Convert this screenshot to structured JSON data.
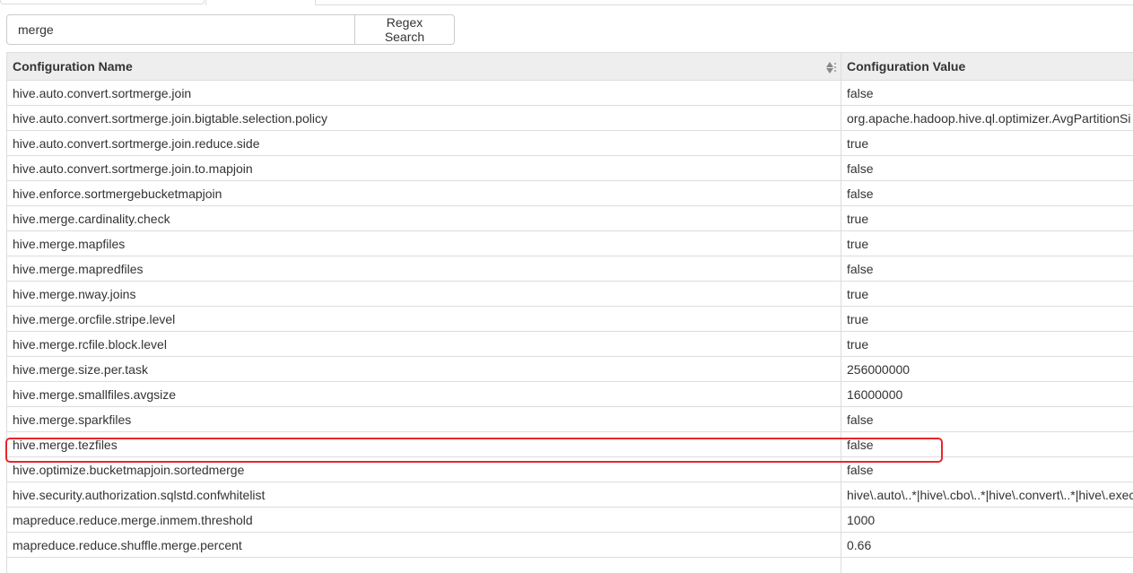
{
  "search": {
    "value": "merge",
    "button_label": "Regex Search"
  },
  "table": {
    "headers": {
      "name": "Configuration Name",
      "value": "Configuration Value"
    },
    "rows": [
      {
        "name": "hive.auto.convert.sortmerge.join",
        "value": "false"
      },
      {
        "name": "hive.auto.convert.sortmerge.join.bigtable.selection.policy",
        "value": "org.apache.hadoop.hive.ql.optimizer.AvgPartitionSi"
      },
      {
        "name": "hive.auto.convert.sortmerge.join.reduce.side",
        "value": "true"
      },
      {
        "name": "hive.auto.convert.sortmerge.join.to.mapjoin",
        "value": "false"
      },
      {
        "name": "hive.enforce.sortmergebucketmapjoin",
        "value": "false"
      },
      {
        "name": "hive.merge.cardinality.check",
        "value": "true"
      },
      {
        "name": "hive.merge.mapfiles",
        "value": "true"
      },
      {
        "name": "hive.merge.mapredfiles",
        "value": "false"
      },
      {
        "name": "hive.merge.nway.joins",
        "value": "true"
      },
      {
        "name": "hive.merge.orcfile.stripe.level",
        "value": "true"
      },
      {
        "name": "hive.merge.rcfile.block.level",
        "value": "true"
      },
      {
        "name": "hive.merge.size.per.task",
        "value": "256000000"
      },
      {
        "name": "hive.merge.smallfiles.avgsize",
        "value": "16000000"
      },
      {
        "name": "hive.merge.sparkfiles",
        "value": "false"
      },
      {
        "name": "hive.merge.tezfiles",
        "value": "false"
      },
      {
        "name": "hive.optimize.bucketmapjoin.sortedmerge",
        "value": "false"
      },
      {
        "name": "hive.security.authorization.sqlstd.confwhitelist",
        "value": "hive\\.auto\\..*|hive\\.cbo\\..*|hive\\.convert\\..*|hive\\.exec"
      },
      {
        "name": "mapreduce.reduce.merge.inmem.threshold",
        "value": "1000"
      },
      {
        "name": "mapreduce.reduce.shuffle.merge.percent",
        "value": "0.66"
      },
      {
        "name": "",
        "value": ""
      }
    ]
  },
  "highlight": {
    "row_name": "hive.merge.tezfiles",
    "color": "#e8262a"
  },
  "colors": {
    "header_bg": "#eeeeee",
    "border": "#dddddd"
  }
}
